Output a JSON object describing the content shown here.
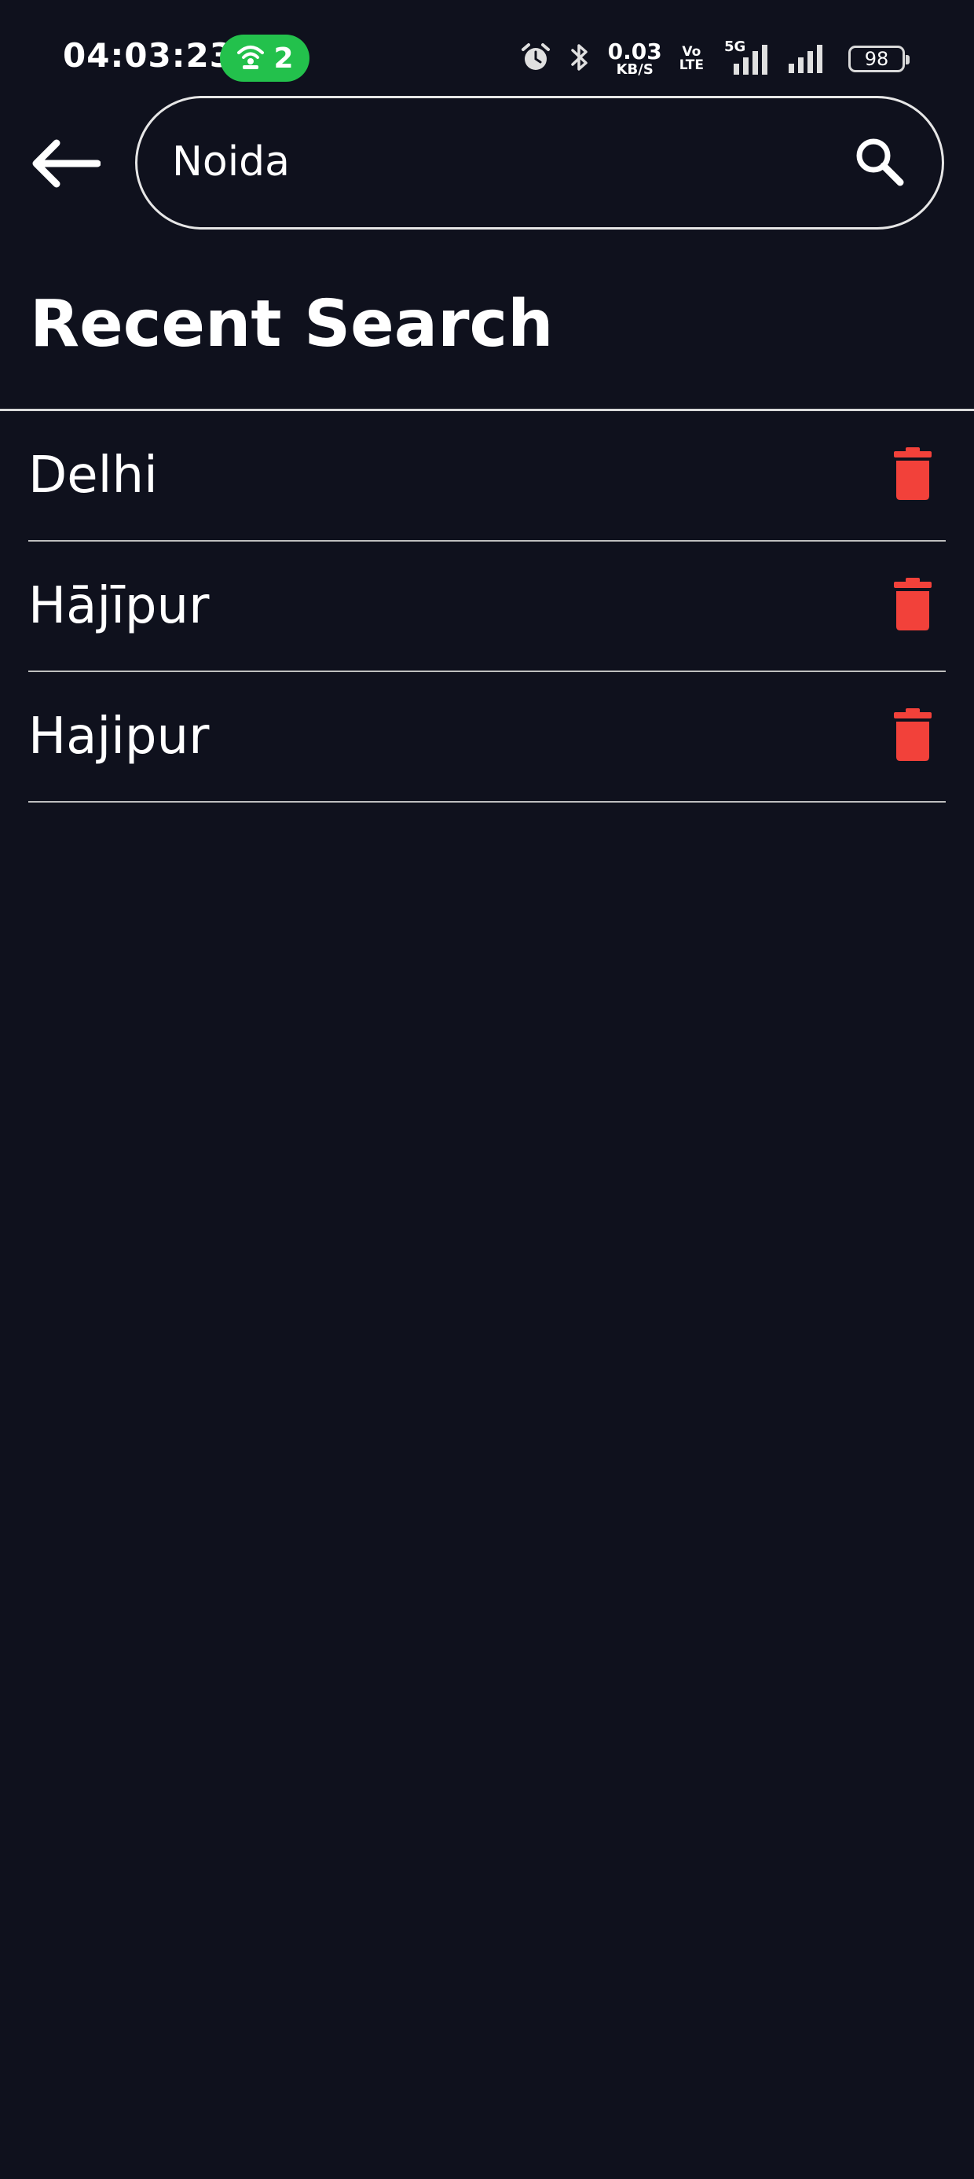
{
  "status_bar": {
    "time": "04:03:23",
    "hotspot_count": "2",
    "net_speed_value": "0.03",
    "net_speed_unit": "KB/S",
    "volte_top": "Vo",
    "volte_bottom": "LTE",
    "network_type": "5G",
    "battery_level": "98"
  },
  "search": {
    "value": "Noida"
  },
  "recent": {
    "title": "Recent Search",
    "items": [
      {
        "label": "Delhi"
      },
      {
        "label": "Hājīpur"
      },
      {
        "label": "Hajipur"
      }
    ]
  },
  "colors": {
    "background": "#0f111d",
    "delete_icon": "#f2413a",
    "hotspot": "#23c14c",
    "divider": "#d9d9d9"
  }
}
